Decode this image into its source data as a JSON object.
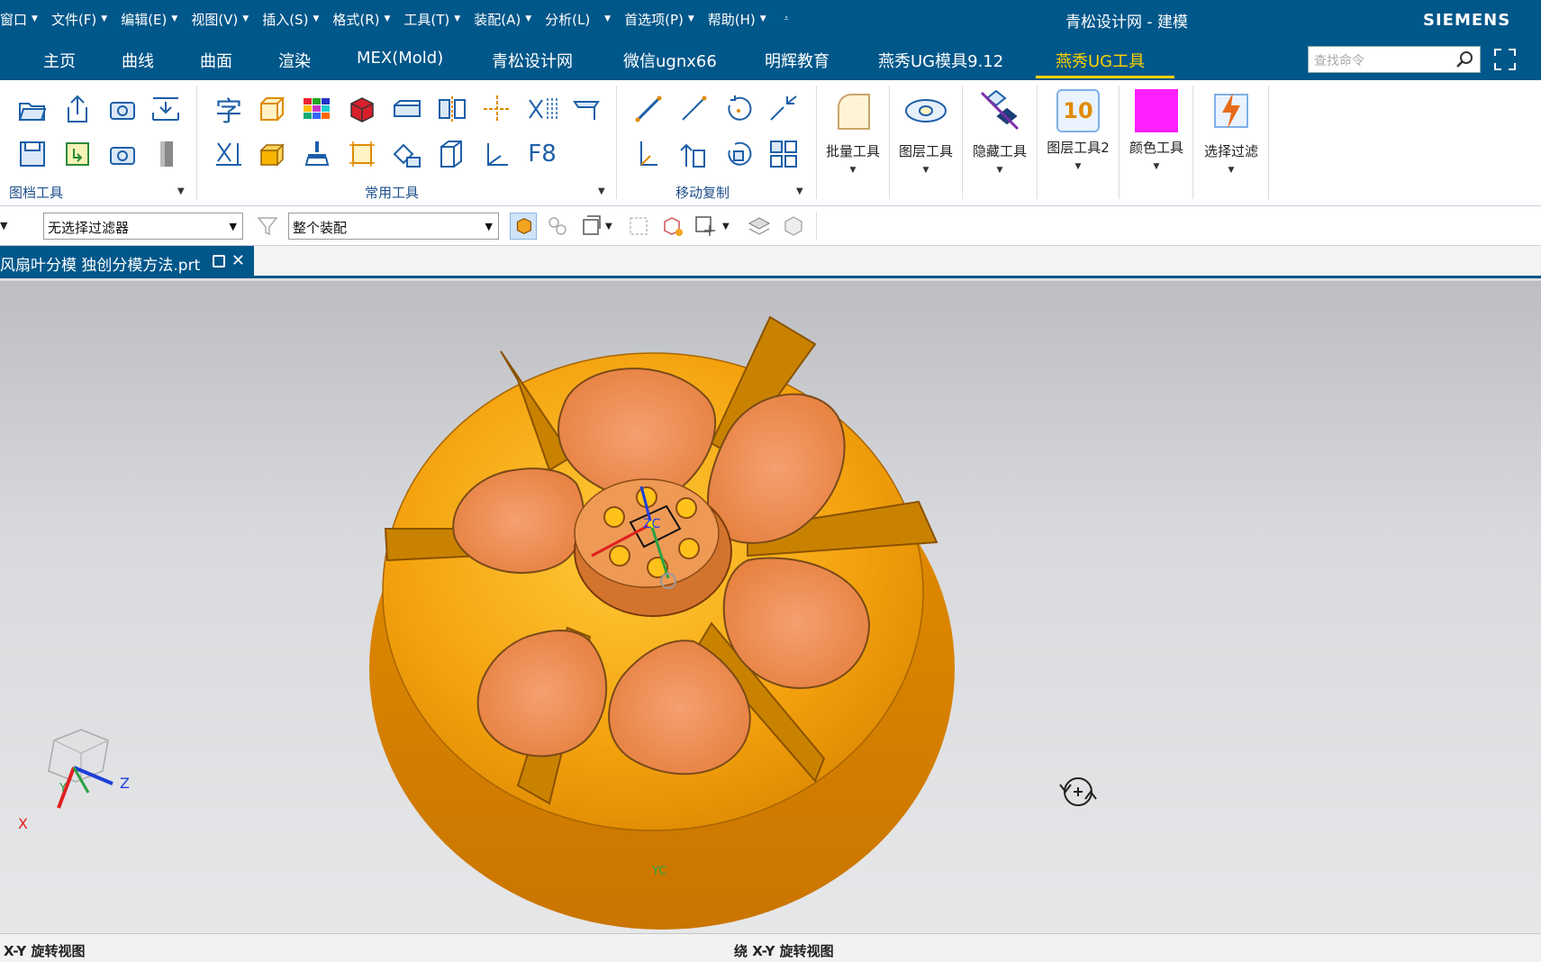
{
  "menu": [
    {
      "label": "窗口"
    },
    {
      "label": "文件(F)"
    },
    {
      "label": "编辑(E)"
    },
    {
      "label": "视图(V)"
    },
    {
      "label": "插入(S)"
    },
    {
      "label": "格式(R)"
    },
    {
      "label": "工具(T)"
    },
    {
      "label": "装配(A)"
    },
    {
      "label": "分析(L)"
    },
    {
      "label": "首选项(P)"
    },
    {
      "label": "帮助(H)"
    }
  ],
  "window_title": "青松设计网 - 建模",
  "brand": "SIEMENS",
  "tabs": [
    {
      "label": "主页"
    },
    {
      "label": "曲线"
    },
    {
      "label": "曲面"
    },
    {
      "label": "渲染"
    },
    {
      "label": "MEX(Mold)"
    },
    {
      "label": "青松设计网"
    },
    {
      "label": "微信ugnx66"
    },
    {
      "label": "明辉教育"
    },
    {
      "label": "燕秀UG模具9.12"
    },
    {
      "label": "燕秀UG工具"
    }
  ],
  "search": {
    "placeholder": "查找命令"
  },
  "ribbon": {
    "groups": {
      "archive": "图档工具",
      "common": "常用工具",
      "move_copy": "移动复制"
    },
    "common_text_icon": "字",
    "f8_icon": "F8",
    "big_buttons": [
      {
        "label": "批量工具"
      },
      {
        "label": "图层工具"
      },
      {
        "label": "隐藏工具"
      },
      {
        "label": "图层工具2",
        "badge": "10"
      },
      {
        "label": "颜色工具",
        "color": "#ff1fff"
      },
      {
        "label": "选择过滤"
      }
    ]
  },
  "selection": {
    "filter": "无选择过滤器",
    "scope": "整个装配"
  },
  "document": {
    "tab_title": "风扇叶分模 独创分模方法.prt"
  },
  "viewport": {
    "wcs_labels": {
      "zc": "ZC",
      "yc": "YC"
    },
    "triad_labels": {
      "x": "X",
      "y": "Y",
      "z": "Z"
    }
  },
  "status": {
    "left": "X-Y 旋转视图",
    "center": "绕 X-Y 旋转视图"
  },
  "colors": {
    "accent": "#00578a",
    "active_tab": "#ffd200",
    "model_body": "#f5a20e",
    "model_face": "#ea8c50"
  }
}
